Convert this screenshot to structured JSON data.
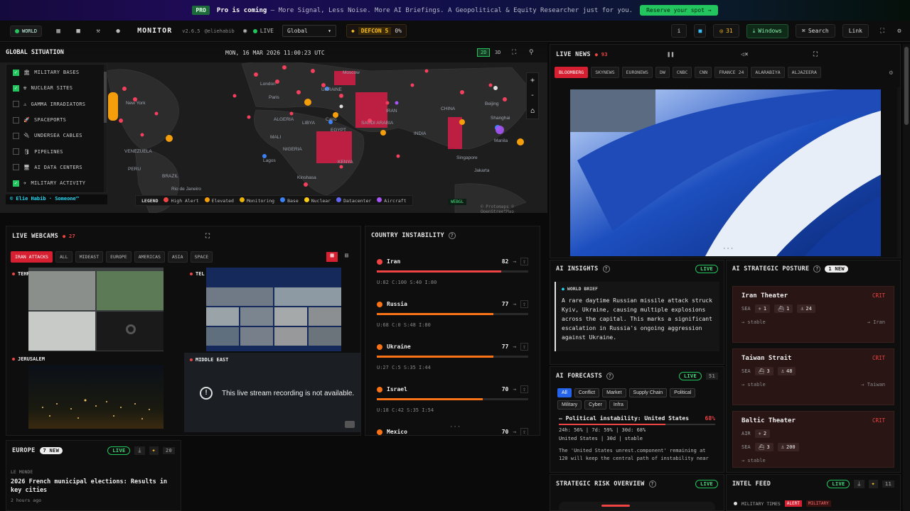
{
  "banner": {
    "pro": "PRO",
    "coming": "Pro is coming",
    "text": "— More Signal, Less Noise. More AI Briefings. A Geopolitical & Equity Researcher just for you.",
    "cta": "Reserve your spot →"
  },
  "topbar": {
    "world": "WORLD",
    "logo": "MONITOR",
    "version": "v2.6.5",
    "handle": "@eliehabib",
    "live": "LIVE",
    "region": "Global",
    "defcon": "DEFCON 5",
    "defcon_pct": "0%",
    "info": "i",
    "alerts": "31",
    "windows": "Windows",
    "search": "Search",
    "link": "Link"
  },
  "map": {
    "title": "GLOBAL SITUATION",
    "datetime": "MON, 16 MAR 2026 11:00:23 UTC",
    "mode2d": "2D",
    "mode3d": "3D",
    "signature": "© Elie Habib · Someone™",
    "webgl": "WEBGL",
    "attribution": "© Protomaps © OpenStreetMap",
    "layers": [
      {
        "label": "MILITARY BASES",
        "on": true,
        "icon": "🏛"
      },
      {
        "label": "NUCLEAR SITES",
        "on": true,
        "icon": "☢"
      },
      {
        "label": "GAMMA IRRADIATORS",
        "on": false,
        "icon": "⚠"
      },
      {
        "label": "SPACEPORTS",
        "on": false,
        "icon": "🚀"
      },
      {
        "label": "UNDERSEA CABLES",
        "on": false,
        "icon": "🔌"
      },
      {
        "label": "PIPELINES",
        "on": false,
        "icon": "🛢"
      },
      {
        "label": "AI DATA CENTERS",
        "on": false,
        "icon": "🖥"
      },
      {
        "label": "MILITARY ACTIVITY",
        "on": true,
        "icon": "✈"
      }
    ],
    "legend": {
      "title": "LEGEND",
      "items": [
        {
          "label": "High Alert",
          "color": "#ef4444"
        },
        {
          "label": "Elevated",
          "color": "#f59e0b"
        },
        {
          "label": "Monitoring",
          "color": "#eab308"
        },
        {
          "label": "Base",
          "color": "#3b82f6"
        },
        {
          "label": "Nuclear",
          "color": "#facc15"
        },
        {
          "label": "Datacenter",
          "color": "#6366f1"
        },
        {
          "label": "Aircraft",
          "color": "#a855f7"
        }
      ]
    },
    "places": [
      "Moscow",
      "London",
      "UKRAINE",
      "Paris",
      "New York",
      "Beijing",
      "Shanghai",
      "Cairo",
      "Manila",
      "Singapore",
      "Jakarta",
      "Rio de Janeiro",
      "BRAZIL",
      "SAUDI ARABIA",
      "EGYPT",
      "KENYA",
      "NIGERIA",
      "MALI",
      "INDIA",
      "VENEZUELA",
      "PERU",
      "ALGERIA",
      "LIBYA",
      "IRAN",
      "CHINA",
      "Lagos",
      "Kinshasa"
    ]
  },
  "news": {
    "title": "LIVE NEWS",
    "count": "93",
    "channels": [
      "BLOOMBERG",
      "SKYNEWS",
      "EURONEWS",
      "DW",
      "CNBC",
      "CNN",
      "FRANCE 24",
      "ALARABIYA",
      "ALJAZEERA"
    ]
  },
  "webcams": {
    "title": "LIVE WEBCAMS",
    "count": "27",
    "filters": [
      "IRAN ATTACKS",
      "ALL",
      "MIDEAST",
      "EUROPE",
      "AMERICAS",
      "ASIA",
      "SPACE"
    ],
    "cams": [
      "TEHRAN",
      "TEL AVIV",
      "JERUSALEM",
      "MIDDLE EAST"
    ],
    "unavailable": "This live stream recording is not available."
  },
  "instability": {
    "title": "COUNTRY INSTABILITY",
    "rows": [
      {
        "name": "Iran",
        "score": "82",
        "pct": 0.82,
        "color": "#ef4444",
        "sub": "U:82  C:100  S:40  I:80"
      },
      {
        "name": "Russia",
        "score": "77",
        "pct": 0.77,
        "color": "#f97316",
        "sub": "U:68  C:0  S:48  I:80"
      },
      {
        "name": "Ukraine",
        "score": "77",
        "pct": 0.77,
        "color": "#f97316",
        "sub": "U:27  C:5  S:35  I:44"
      },
      {
        "name": "Israel",
        "score": "70",
        "pct": 0.7,
        "color": "#f97316",
        "sub": "U:18  C:42  S:35  I:54"
      },
      {
        "name": "Mexico",
        "score": "70",
        "pct": 0.7,
        "color": "#f97316",
        "sub": ""
      }
    ]
  },
  "insights": {
    "title": "AI INSIGHTS",
    "live": "LIVE",
    "brief_label": "WORLD BRIEF",
    "brief": "A rare daytime Russian missile attack struck Kyiv, Ukraine, causing multiple explosions across the capital. This marks a significant escalation in Russia's ongoing aggression against Ukraine."
  },
  "posture": {
    "title": "AI STRATEGIC POSTURE",
    "new": "1 NEW",
    "theaters": [
      {
        "name": "Iran Theater",
        "level": "CRIT",
        "rows": [
          {
            "k": "SEA",
            "items": [
              "1",
              "1",
              "24"
            ]
          }
        ],
        "trend": "→ stable",
        "tag": "→ Iran"
      },
      {
        "name": "Taiwan Strait",
        "level": "CRIT",
        "rows": [
          {
            "k": "SEA",
            "items": [
              "3",
              "48"
            ]
          }
        ],
        "trend": "→ stable",
        "tag": "→ Taiwan"
      },
      {
        "name": "Baltic Theater",
        "level": "CRIT",
        "rows": [
          {
            "k": "AIR",
            "items": [
              "2"
            ]
          },
          {
            "k": "SEA",
            "items": [
              "3",
              "200"
            ]
          }
        ],
        "trend": "→ stable",
        "tag": ""
      }
    ]
  },
  "forecasts": {
    "title": "AI FORECASTS",
    "live": "LIVE",
    "count": "51",
    "chips": [
      "All",
      "Conflict",
      "Market",
      "Supply Chain",
      "Political",
      "Military",
      "Cyber",
      "Infra"
    ],
    "item_title": "Political instability: United States",
    "item_pct": "68%",
    "stats": "24h: 56% | 7d: 59% | 30d: 68%",
    "meta": "United States | 30d | stable",
    "body": "The 'United States unrest.component' remaining at 120 will keep the central path of instability near"
  },
  "europe": {
    "title": "EUROPE",
    "new": "7 NEW",
    "live": "LIVE",
    "count": "20",
    "source": "LE MONDE",
    "headline": "2026 French municipal elections: Results in key cities",
    "time": "2 hours ago"
  },
  "risk": {
    "title": "STRATEGIC RISK OVERVIEW",
    "live": "LIVE"
  },
  "intel": {
    "title": "INTEL FEED",
    "live": "LIVE",
    "count": "11",
    "source": "MILITARY TIMES",
    "alert": "ALERT",
    "tag": "MILITARY"
  }
}
